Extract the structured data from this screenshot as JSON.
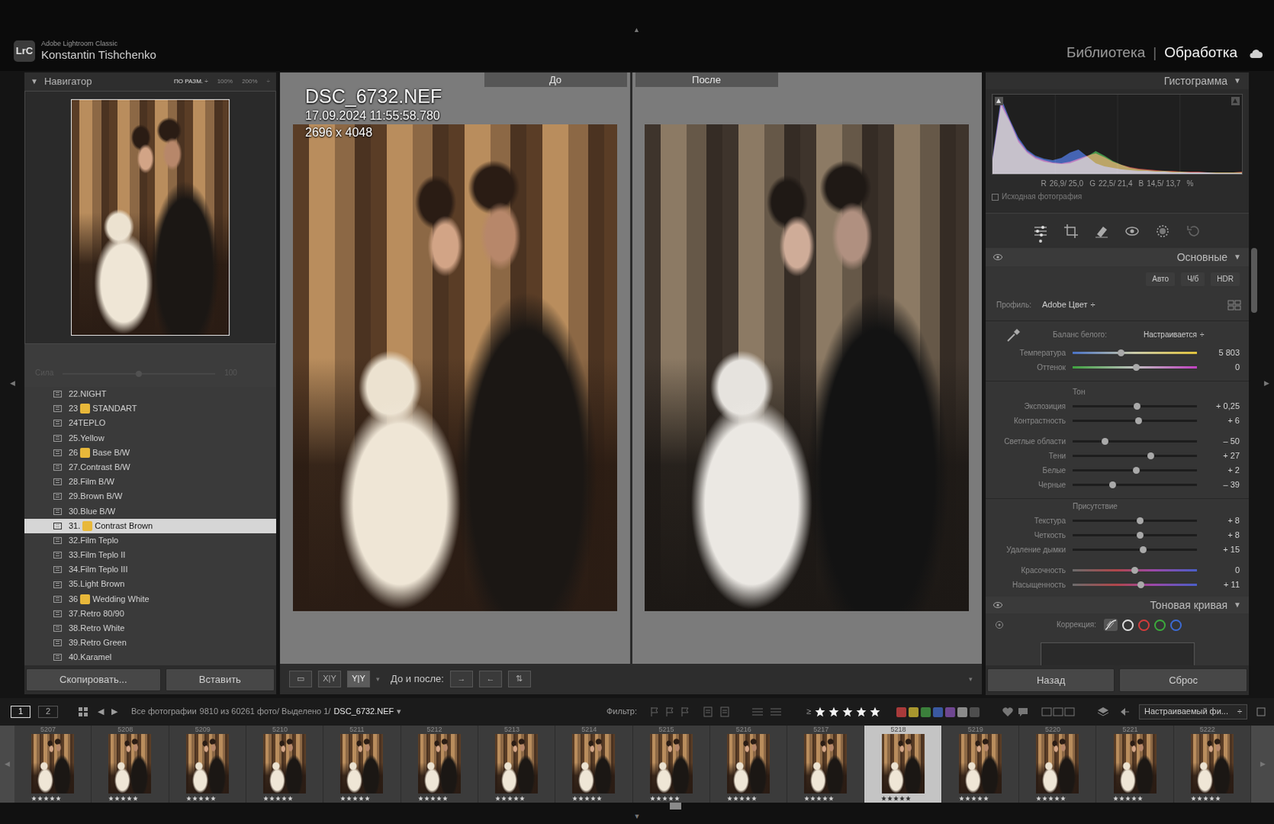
{
  "app": {
    "logo": "LrC",
    "product": "Adobe Lightroom Classic",
    "user": "Konstantin Tishchenko"
  },
  "modules": [
    {
      "label": "Библиотека",
      "selected": false
    },
    {
      "label": "Обработка",
      "selected": true
    }
  ],
  "module_separator": "|",
  "edge_arrows": {
    "top": "▲",
    "bottom": "▼",
    "left": "◀",
    "right": "▶"
  },
  "strip_arrows": {
    "left": "◀",
    "right": "▶"
  },
  "navigator": {
    "title": "Навигатор",
    "toggle": "▼",
    "expanded": true,
    "zoom": [
      {
        "label": "ПО РАЗМ. ÷",
        "selected": true
      },
      {
        "label": "100%",
        "selected": false
      },
      {
        "label": "200%",
        "selected": false
      }
    ],
    "zoom_more": "÷"
  },
  "presets": {
    "amount_label": "Сила",
    "amount_value": "100",
    "amount_level": 0.5,
    "disabled": true,
    "items": [
      {
        "kind": "plain",
        "label": "22.NIGHT",
        "selected": false
      },
      {
        "kind": "tagged",
        "prefix": "23",
        "label": "STANDART",
        "selected": false
      },
      {
        "kind": "plain",
        "label": "24TEPLO",
        "selected": false
      },
      {
        "kind": "plain",
        "label": "25.Yellow",
        "selected": false
      },
      {
        "kind": "tagged",
        "prefix": "26",
        "label": "Base B/W",
        "selected": false
      },
      {
        "kind": "plain",
        "label": "27.Contrast B/W",
        "selected": false
      },
      {
        "kind": "plain",
        "label": "28.Film B/W",
        "selected": false
      },
      {
        "kind": "plain",
        "label": "29.Brown B/W",
        "selected": false
      },
      {
        "kind": "plain",
        "label": "30.Blue B/W",
        "selected": false
      },
      {
        "kind": "tagged",
        "prefix": "31.",
        "label": "Contrast Brown",
        "selected": true
      },
      {
        "kind": "plain",
        "label": "32.Film Teplo",
        "selected": false
      },
      {
        "kind": "plain",
        "label": "33.Film Teplo II",
        "selected": false
      },
      {
        "kind": "plain",
        "label": "34.Film Teplo III",
        "selected": false
      },
      {
        "kind": "plain",
        "label": "35.Light Brown",
        "selected": false
      },
      {
        "kind": "tagged",
        "prefix": "36",
        "label": "Wedding White",
        "selected": false
      },
      {
        "kind": "plain",
        "label": "37.Retro 80/90",
        "selected": false
      },
      {
        "kind": "plain",
        "label": "38.Retro White",
        "selected": false
      },
      {
        "kind": "plain",
        "label": "39.Retro Green",
        "selected": false
      },
      {
        "kind": "plain",
        "label": "40.Karamel",
        "selected": false
      }
    ]
  },
  "left_buttons": [
    {
      "label": "Скопировать..."
    },
    {
      "label": "Вставить"
    }
  ],
  "photo": {
    "filename": "DSC_6732.NEF",
    "datetime": "17.09.2024 11:55:58.780",
    "dimensions": "2696 x 4048"
  },
  "compare": [
    {
      "label": "До"
    },
    {
      "label": "После"
    }
  ],
  "toolbar": {
    "views": [
      {
        "glyph": "▭",
        "selected": false
      },
      {
        "glyph": "X|Y",
        "selected": false
      },
      {
        "glyph": "Y|Y",
        "selected": true
      }
    ],
    "view_menu": "▾",
    "before_after_label": "До и после:",
    "swap_buttons": [
      "→",
      "←",
      "⇅"
    ],
    "more": "▾"
  },
  "histogram": {
    "title": "Гистограмма",
    "toggle": "▼",
    "series": [
      {
        "color": "#d83a3a",
        "values": [
          20,
          95,
          70,
          45,
          30,
          22,
          18,
          15,
          14,
          16,
          20,
          24,
          27,
          22,
          16,
          12,
          9,
          7,
          6,
          5,
          4,
          4,
          3,
          3,
          3,
          2,
          2,
          2,
          2,
          3
        ]
      },
      {
        "color": "#38b040",
        "values": [
          18,
          90,
          68,
          42,
          28,
          20,
          16,
          14,
          13,
          14,
          18,
          23,
          30,
          24,
          17,
          12,
          8,
          6,
          5,
          4,
          4,
          3,
          3,
          2,
          2,
          2,
          2,
          2,
          2,
          2
        ]
      },
      {
        "color": "#3a6ae0",
        "values": [
          22,
          100,
          72,
          48,
          32,
          24,
          20,
          18,
          21,
          28,
          32,
          23,
          14,
          10,
          8,
          6,
          5,
          4,
          4,
          3,
          3,
          2,
          2,
          2,
          2,
          2,
          1,
          1,
          1,
          1
        ]
      }
    ],
    "readout": [
      {
        "label": "R",
        "value": "26,9/ 25,0"
      },
      {
        "label": "G",
        "value": "22,5/ 21,4"
      },
      {
        "label": "B",
        "value": "14,5/ 13,7"
      }
    ],
    "unit": "%",
    "original": {
      "label": "Исходная фотография",
      "checked": false
    }
  },
  "tools": [
    {
      "selected": true
    },
    {
      "selected": false
    },
    {
      "selected": false
    },
    {
      "selected": false
    },
    {
      "selected": false
    },
    {
      "selected": false
    }
  ],
  "basic": {
    "title": "Основные",
    "toggle": "▼",
    "visible": true,
    "treatments": [
      {
        "label": "Авто"
      },
      {
        "label": "Ч/б"
      },
      {
        "label": "HDR"
      }
    ],
    "profile": {
      "label": "Профиль:",
      "value": "Adobe Цвет",
      "arrow": "÷"
    },
    "wb": {
      "label": "Баланс белого:",
      "value": "Настраивается",
      "arrow": "÷",
      "sliders": [
        {
          "label": "Температура",
          "value": "5 803",
          "level": 0.39,
          "track": "temperature"
        },
        {
          "label": "Оттенок",
          "value": "0",
          "level": 0.51,
          "track": "tint"
        }
      ]
    },
    "groups": [
      {
        "title": "Тон",
        "blocks": [
          [
            {
              "label": "Экспозиция",
              "value": "+ 0,25",
              "level": 0.52,
              "track": "plain"
            },
            {
              "label": "Контрастность",
              "value": "+ 6",
              "level": 0.53,
              "track": "plain"
            }
          ],
          [
            {
              "label": "Светлые области",
              "value": "– 50",
              "level": 0.26,
              "track": "plain"
            },
            {
              "label": "Тени",
              "value": "+ 27",
              "level": 0.63,
              "track": "plain"
            },
            {
              "label": "Белые",
              "value": "+ 2",
              "level": 0.51,
              "track": "plain"
            },
            {
              "label": "Черные",
              "value": "– 39",
              "level": 0.32,
              "track": "plain"
            }
          ]
        ]
      },
      {
        "title": "Присутствие",
        "blocks": [
          [
            {
              "label": "Текстура",
              "value": "+ 8",
              "level": 0.54,
              "track": "plain"
            },
            {
              "label": "Четкость",
              "value": "+ 8",
              "level": 0.54,
              "track": "plain"
            },
            {
              "label": "Удаление дымки",
              "value": "+ 15",
              "level": 0.57,
              "track": "plain"
            }
          ],
          [
            {
              "label": "Красочность",
              "value": "0",
              "level": 0.5,
              "track": "vibrance"
            },
            {
              "label": "Насыщенность",
              "value": "+ 11",
              "level": 0.55,
              "track": "saturation"
            }
          ]
        ]
      }
    ]
  },
  "tone_curve": {
    "title": "Тоновая кривая",
    "toggle": "▼",
    "visible": true,
    "label": "Коррекция:",
    "channels": [
      {
        "kind": "parametric",
        "selected": true
      },
      {
        "kind": "channel",
        "color": "#dcdcdc",
        "selected": false
      },
      {
        "kind": "channel",
        "color": "#d23c3c",
        "selected": false
      },
      {
        "kind": "channel",
        "color": "#3caa3c",
        "selected": false
      },
      {
        "kind": "channel",
        "color": "#3c6ad2",
        "selected": false
      }
    ]
  },
  "right_buttons": [
    {
      "label": "Назад"
    },
    {
      "label": "Сброс"
    }
  ],
  "filmbar": {
    "screens": [
      {
        "label": "1",
        "selected": true
      },
      {
        "label": "2",
        "selected": false
      }
    ],
    "prev": "◀",
    "next": "▶",
    "source": "Все фотографии",
    "count": "9810 из 60261 фото/ Выделено 1/",
    "file": "DSC_6732.NEF",
    "file_menu": "▾",
    "filter_label": "Фильтр:",
    "rating_op": "≥",
    "stars": 5,
    "color_labels": [
      {
        "color": "#a83a3a"
      },
      {
        "color": "#a8962e"
      },
      {
        "color": "#3b7f3b"
      },
      {
        "color": "#3a58a0"
      },
      {
        "color": "#6e4690"
      },
      {
        "color": "#8a8a8a"
      },
      {
        "color": "#4e4e4e"
      }
    ],
    "custom_filter": "Настраиваемый фи...",
    "filter_menu": "÷"
  },
  "thumbnails": [
    {
      "number": "5207",
      "stars": 5,
      "selected": false
    },
    {
      "number": "5208",
      "stars": 5,
      "selected": false
    },
    {
      "number": "5209",
      "stars": 5,
      "selected": false
    },
    {
      "number": "5210",
      "stars": 5,
      "selected": false
    },
    {
      "number": "5211",
      "stars": 5,
      "selected": false
    },
    {
      "number": "5212",
      "stars": 5,
      "selected": false
    },
    {
      "number": "5213",
      "stars": 5,
      "selected": false
    },
    {
      "number": "5214",
      "stars": 5,
      "selected": false
    },
    {
      "number": "5215",
      "stars": 5,
      "selected": false
    },
    {
      "number": "5216",
      "stars": 5,
      "selected": false
    },
    {
      "number": "5217",
      "stars": 5,
      "selected": false
    },
    {
      "number": "5218",
      "stars": 5,
      "selected": true
    },
    {
      "number": "5219",
      "stars": 5,
      "selected": false
    },
    {
      "number": "5220",
      "stars": 5,
      "selected": false
    },
    {
      "number": "5221",
      "stars": 5,
      "selected": false
    },
    {
      "number": "5222",
      "stars": 5,
      "selected": false
    }
  ]
}
